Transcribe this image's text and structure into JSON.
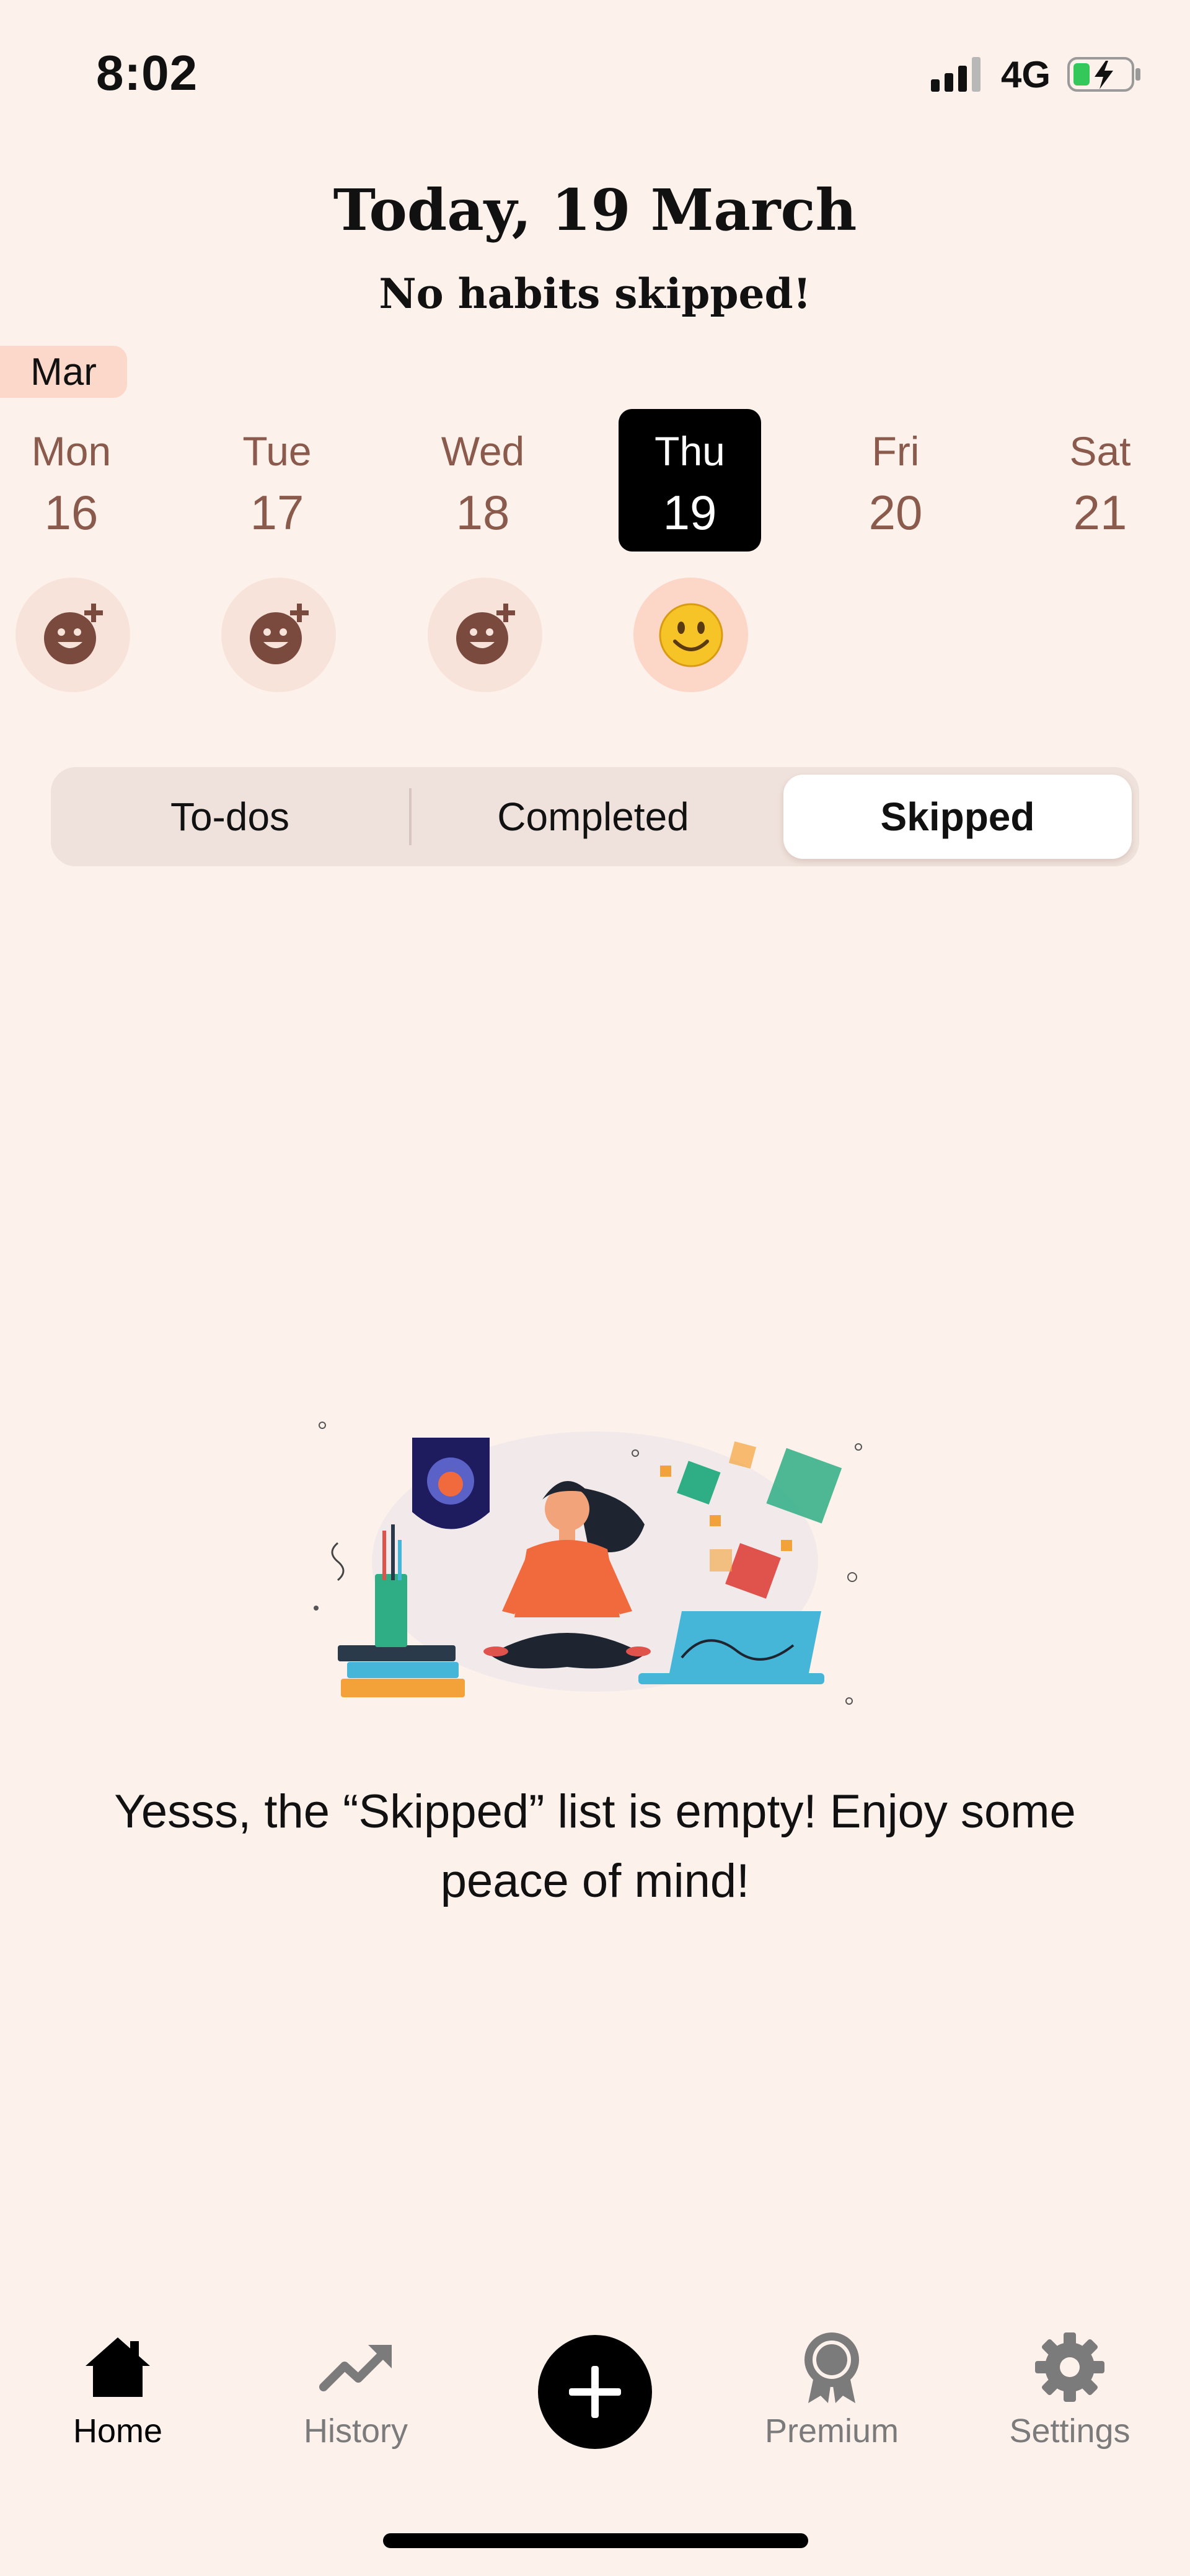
{
  "status": {
    "time": "8:02",
    "network": "4G"
  },
  "header": {
    "title": "Today, 19 March",
    "subtitle": "No habits skipped!"
  },
  "week": {
    "month": "Mar",
    "days": [
      {
        "name": "Mon",
        "date": "16"
      },
      {
        "name": "Tue",
        "date": "17"
      },
      {
        "name": "Wed",
        "date": "18"
      },
      {
        "name": "Thu",
        "date": "19"
      },
      {
        "name": "Fri",
        "date": "20"
      },
      {
        "name": "Sat",
        "date": "21"
      }
    ],
    "selected_index": 3
  },
  "tabs": [
    {
      "label": "To-dos"
    },
    {
      "label": "Completed"
    },
    {
      "label": "Skipped"
    }
  ],
  "active_tab": "Skipped",
  "empty_state": {
    "message": "Yesss, the “Skipped” list is empty! Enjoy some peace of mind!"
  },
  "nav": [
    {
      "label": "Home",
      "icon": "home-icon"
    },
    {
      "label": "History",
      "icon": "trending-up-icon"
    },
    {
      "label": "Premium",
      "icon": "award-icon"
    },
    {
      "label": "Settings",
      "icon": "gear-icon"
    }
  ],
  "colors": {
    "background": "#fdf1eb",
    "accent_pill": "#fbd8c9",
    "selected_day": "#000000",
    "day_text": "#8a5a4c"
  }
}
